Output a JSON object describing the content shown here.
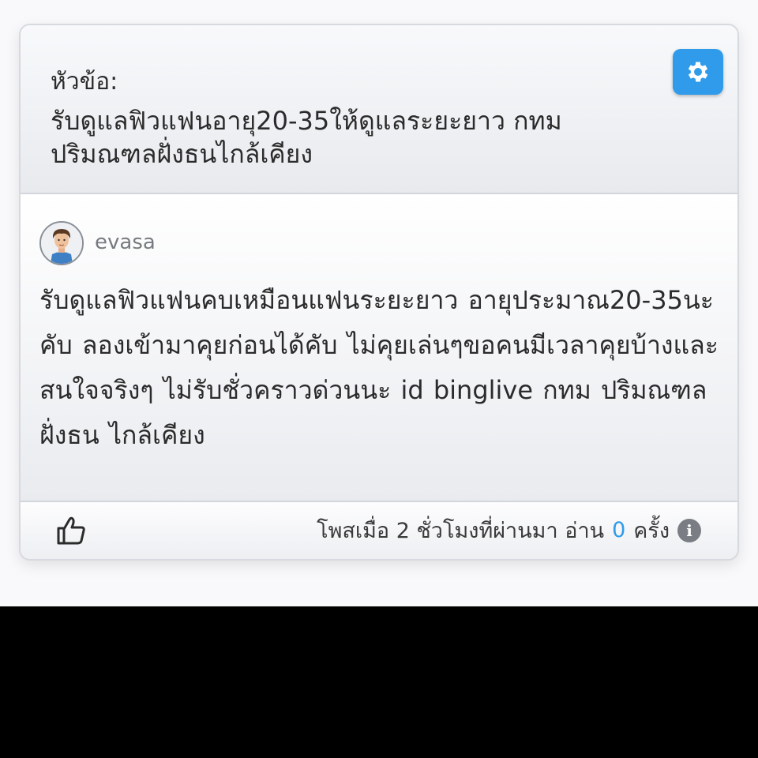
{
  "header": {
    "topic_label": "หัวข้อ:",
    "topic_title": "รับดูแลฟิวแฟนอายุ20-35ให้ดูแลระยะยาว กทม ปริมณฑลฝั่งธนไกล้เคียง"
  },
  "post": {
    "author": "evasa",
    "body": "รับดูแลฟิวแฟนคบเหมือนแฟนระยะยาว อายุประมาณ20-35นะคับ ลองเข้ามาคุยก่อนได้คับ ไม่คุยเล่นๆขอคนมีเวลาคุยบ้างและสนใจจริงๆ      ไม่รับชั่วคราวด่วนนะ  id  binglive  กทม ปริมณฑล ฝั่งธน ไกล้เคียง"
  },
  "footer": {
    "posted_text": "โพสเมื่อ 2 ชั่วโมงที่ผ่านมา อ่าน",
    "read_count": "0",
    "read_unit": "ครั้ง",
    "info_glyph": "i"
  },
  "icons": {
    "settings": "gear-icon",
    "like": "thumbs-up-icon",
    "info": "info-icon",
    "avatar": "user-avatar"
  },
  "colors": {
    "accent": "#2f9bea",
    "text": "#2b2b2b",
    "muted": "#777b80"
  }
}
